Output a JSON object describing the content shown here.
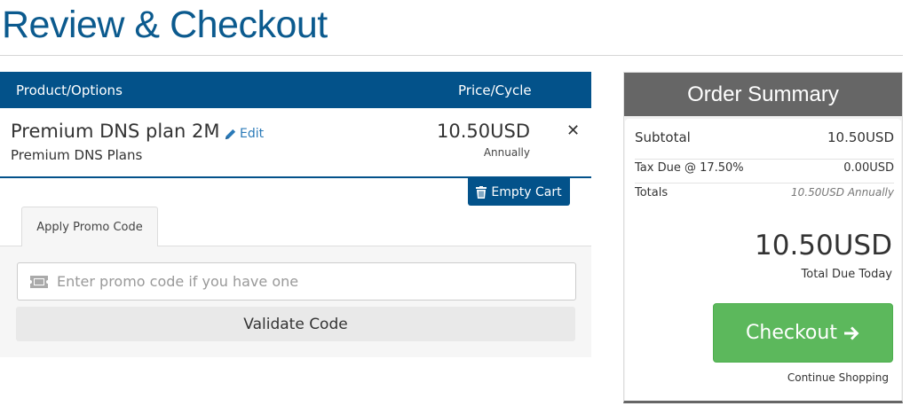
{
  "page": {
    "title": "Review & Checkout"
  },
  "cart": {
    "header": {
      "product_label": "Product/Options",
      "price_label": "Price/Cycle"
    },
    "item": {
      "name": "Premium DNS plan 2M",
      "edit_label": "Edit",
      "group": "Premium DNS Plans",
      "price": "10.50USD",
      "cycle": "Annually",
      "remove_icon": "close-icon"
    },
    "empty_cart_label": "Empty Cart",
    "empty_cart_icon": "trash-icon"
  },
  "promo": {
    "tab_label": "Apply Promo Code",
    "input_placeholder": "Enter promo code if you have one",
    "input_icon": "ticket-icon",
    "validate_label": "Validate Code"
  },
  "summary": {
    "title": "Order Summary",
    "rows": [
      {
        "label": "Subtotal",
        "value": "10.50USD"
      },
      {
        "label": "Tax Due @ 17.50%",
        "value": "0.00USD"
      },
      {
        "label": "Totals",
        "value": "10.50USD Annually"
      }
    ],
    "total": "10.50USD",
    "total_label": "Total Due Today",
    "checkout_label": "Checkout",
    "checkout_icon": "arrow-right-icon",
    "continue_label": "Continue Shopping"
  },
  "colors": {
    "primary": "#03528a",
    "title": "#0b5a8e",
    "success": "#5cb85c",
    "summary_header": "#666666"
  }
}
